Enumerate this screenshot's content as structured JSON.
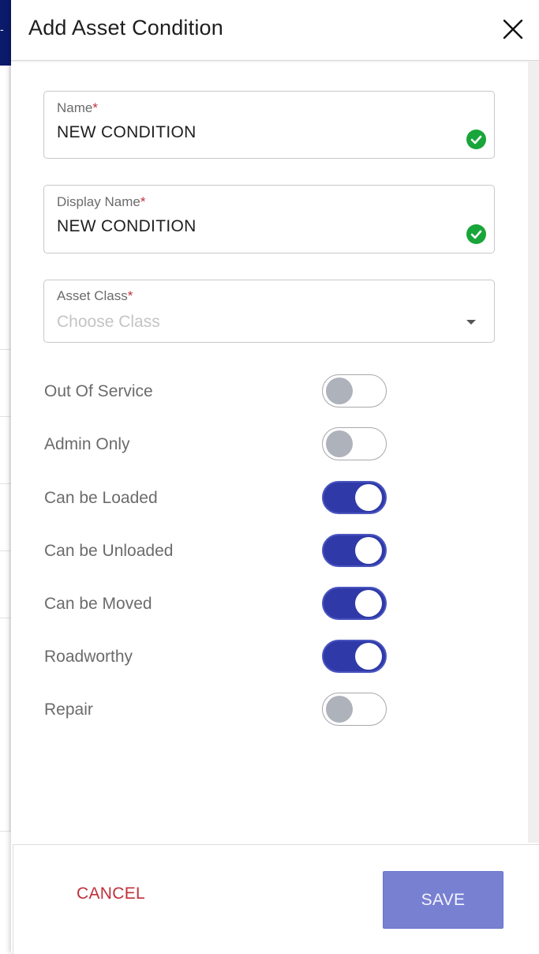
{
  "drawer": {
    "title": "Add Asset Condition"
  },
  "form": {
    "name": {
      "label": "Name",
      "required_mark": "*",
      "value": "NEW CONDITION"
    },
    "display_name": {
      "label": "Display Name",
      "required_mark": "*",
      "value": "NEW CONDITION"
    },
    "asset_class": {
      "label": "Asset Class",
      "required_mark": "*",
      "placeholder": "Choose Class"
    }
  },
  "toggles": [
    {
      "label": "Out Of Service",
      "checked": false
    },
    {
      "label": "Admin Only",
      "checked": false
    },
    {
      "label": "Can be Loaded",
      "checked": true
    },
    {
      "label": "Can be Unloaded",
      "checked": true
    },
    {
      "label": "Can be Moved",
      "checked": true
    },
    {
      "label": "Roadworthy",
      "checked": true
    },
    {
      "label": "Repair",
      "checked": false
    }
  ],
  "footer": {
    "cancel_label": "CANCEL",
    "save_label": "SAVE"
  },
  "colors": {
    "accent": "#2f3aa8",
    "save_button": "#7880d2",
    "cancel_text": "#c0303a",
    "valid": "#18a53a",
    "navbar": "#0b1a6b"
  },
  "icons": {
    "close": "close-icon",
    "valid": "check-circle-icon",
    "dropdown": "caret-down-icon"
  }
}
